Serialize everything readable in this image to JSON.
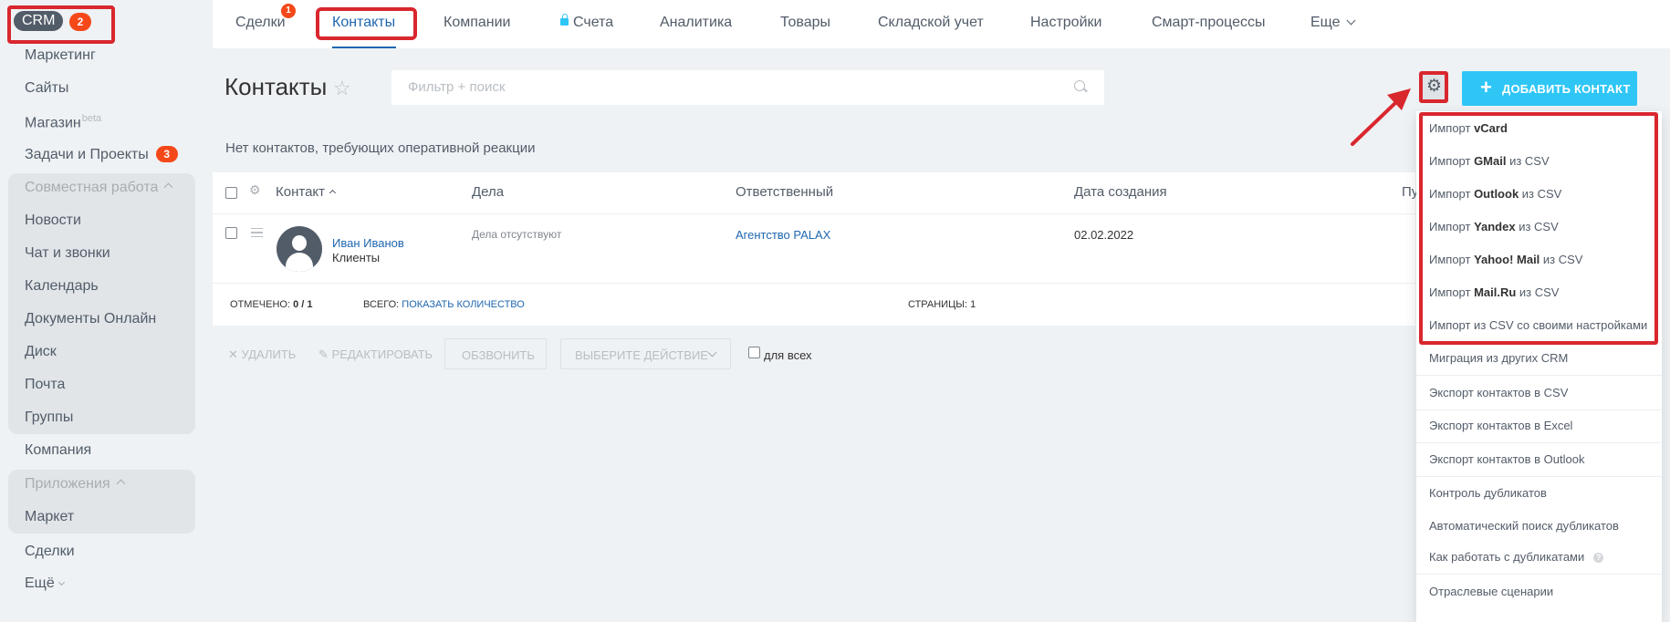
{
  "sidebar": {
    "crm_label": "CRM",
    "crm_badge": "2",
    "items": [
      {
        "label": "Маркетинг"
      },
      {
        "label": "Сайты"
      },
      {
        "label": "Магазин",
        "sup": "beta"
      },
      {
        "label": "Задачи и Проекты",
        "badge": "3"
      }
    ],
    "group1_title": "Совместная работа",
    "group1_items": [
      "Новости",
      "Чат и звонки",
      "Календарь",
      "Документы Онлайн",
      "Диск",
      "Почта",
      "Группы"
    ],
    "company": "Компания",
    "group2_title": "Приложения",
    "group2_items": [
      "Маркет"
    ],
    "deals": "Сделки",
    "more": "Ещё"
  },
  "topnav": {
    "items": [
      "Сделки",
      "Контакты",
      "Компании",
      "Счета",
      "Аналитика",
      "Товары",
      "Складской учет",
      "Настройки",
      "Смарт-процессы",
      "Еще"
    ],
    "deals_badge": "1",
    "active": "Контакты"
  },
  "header": {
    "title": "Контакты",
    "search_placeholder": "Фильтр + поиск",
    "add_button": "ДОБАВИТЬ КОНТАКТ"
  },
  "notice": "Нет контактов, требующих оперативной реакции",
  "grid": {
    "columns": [
      "Контакт",
      "Дела",
      "Ответственный",
      "Дата создания",
      "Пу"
    ],
    "rows": [
      {
        "name": "Иван Иванов",
        "type": "Клиенты",
        "activities": "Дела отсутствуют",
        "responsible": "Агентство PALAX",
        "created": "02.02.2022"
      }
    ],
    "footer": {
      "selected_label": "ОТМЕЧЕНО:",
      "selected_value": "0 / 1",
      "total_label": "ВСЕГО:",
      "total_link": "ПОКАЗАТЬ КОЛИЧЕСТВО",
      "pages_label": "СТРАНИЦЫ:",
      "pages_value": "1"
    }
  },
  "actions": {
    "delete": "УДАЛИТЬ",
    "edit": "РЕДАКТИРОВАТЬ",
    "call": "ОБЗВОНИТЬ",
    "choose": "ВЫБЕРИТЕ ДЕЙСТВИЕ",
    "for_all": "для всех"
  },
  "menu": {
    "import_items": [
      {
        "pre": "Импорт ",
        "bold": "vCard",
        "post": ""
      },
      {
        "pre": "Импорт ",
        "bold": "GMail",
        "post": " из CSV"
      },
      {
        "pre": "Импорт ",
        "bold": "Outlook",
        "post": " из CSV"
      },
      {
        "pre": "Импорт ",
        "bold": "Yandex",
        "post": " из CSV"
      },
      {
        "pre": "Импорт ",
        "bold": "Yahoo! Mail",
        "post": " из CSV"
      },
      {
        "pre": "Импорт ",
        "bold": "Mail.Ru",
        "post": " из CSV"
      },
      {
        "pre": "Импорт из CSV со своими настройками",
        "bold": "",
        "post": ""
      }
    ],
    "migration": "Миграция из других CRM",
    "export_csv": "Экспорт контактов в CSV",
    "export_excel": "Экспорт контактов в Excel",
    "export_outlook": "Экспорт контактов в Outlook",
    "dup_control": "Контроль дубликатов",
    "dup_auto": "Автоматический поиск дубликатов",
    "dup_help": "Как работать с дубликатами",
    "scenarios": "Отраслевые сценарии"
  },
  "colors": {
    "accent": "#2067b0",
    "add_button": "#2fc6f6",
    "badge": "#f54819",
    "highlight": "#d9272e"
  }
}
